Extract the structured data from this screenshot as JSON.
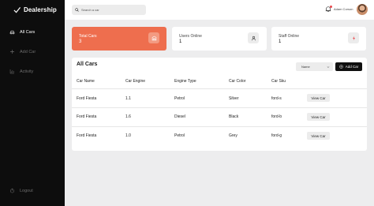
{
  "sidebar": {
    "brand": "Dealership",
    "items": [
      {
        "label": "All Cars",
        "icon": "car-icon"
      },
      {
        "label": "Add Car",
        "icon": "plus-icon"
      },
      {
        "label": "Activity",
        "icon": "activity-icon"
      }
    ],
    "logout": "Logout"
  },
  "topbar": {
    "search_placeholder": "Search a car",
    "user_name": "Adam Corson"
  },
  "stats": [
    {
      "label": "Total Cars",
      "value": "3"
    },
    {
      "label": "Users Online",
      "value": "1"
    },
    {
      "label": "Staff Online",
      "value": "1"
    }
  ],
  "panel": {
    "title": "All Cars",
    "sort_value": "Name",
    "add_label": "Add Car",
    "columns": [
      "Car Name",
      "Car Engine",
      "Engine Type",
      "Car Color",
      "Car Sku"
    ],
    "rows": [
      {
        "name": "Ford Fiesta",
        "engine": "1.1",
        "type": "Petrol",
        "color": "Silver",
        "sku": "ford-s"
      },
      {
        "name": "Ford Fiesta",
        "engine": "1.6",
        "type": "Diesel",
        "color": "Black",
        "sku": "ford-b"
      },
      {
        "name": "Ford Fiesta",
        "engine": "1.0",
        "type": "Petrol",
        "color": "Grey",
        "sku": "ford-g"
      }
    ],
    "view_label": "View Car"
  },
  "colors": {
    "accent": "#ee6e4e",
    "sidebar": "#0d0d0d",
    "notification": "#e8474c"
  }
}
